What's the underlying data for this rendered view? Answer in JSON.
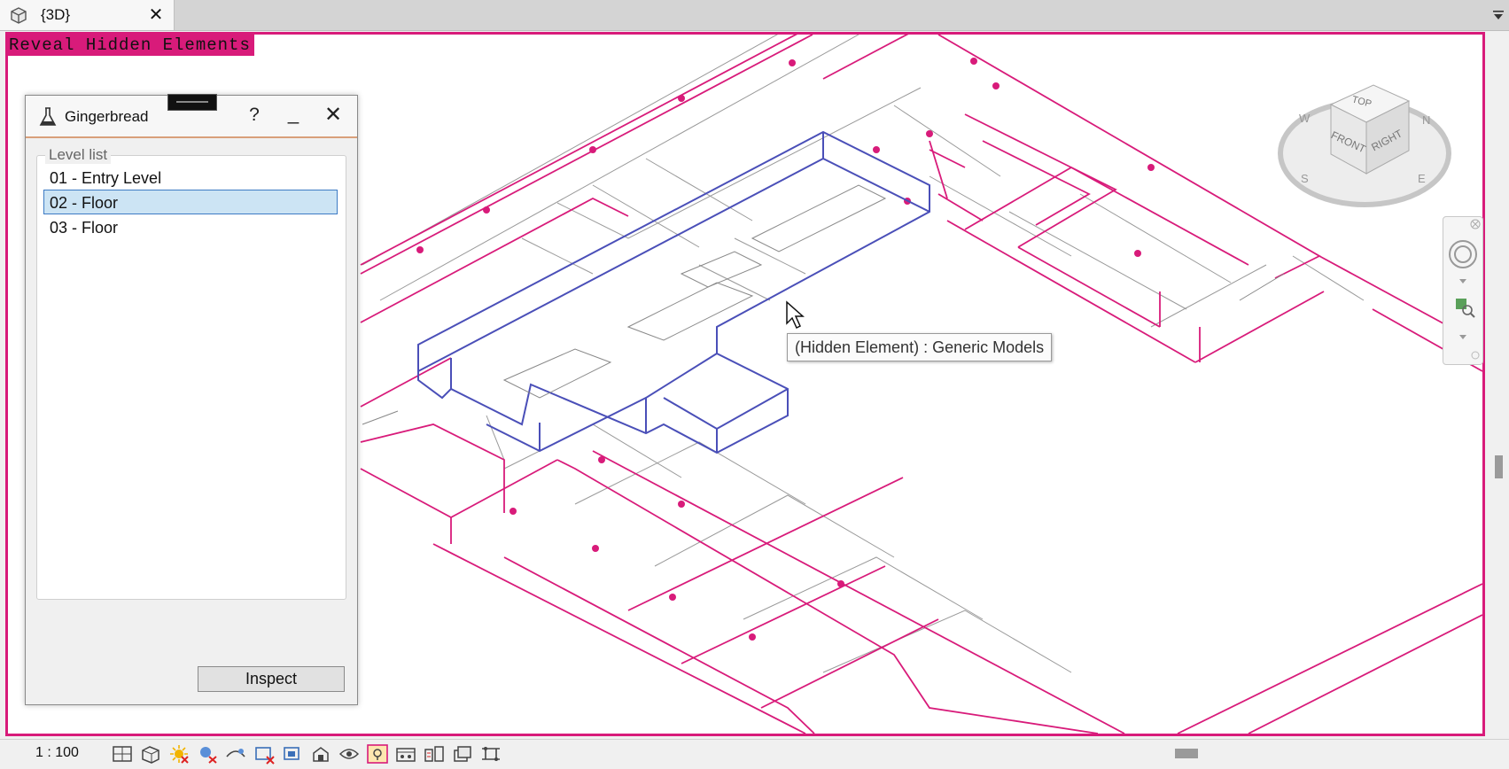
{
  "tab": {
    "label": "{3D}",
    "close": "✕"
  },
  "banner": {
    "text": "Reveal Hidden Elements"
  },
  "dialog": {
    "title": "Gingerbread",
    "help": "?",
    "minimize": "_",
    "close": "✕",
    "group_label": "Level list",
    "levels": [
      {
        "label": "01 - Entry Level",
        "selected": false
      },
      {
        "label": "02 - Floor",
        "selected": true
      },
      {
        "label": "03 - Floor",
        "selected": false
      }
    ],
    "inspect_label": "Inspect"
  },
  "tooltip": {
    "text": "(Hidden Element) : Generic Models"
  },
  "viewcube": {
    "top": "TOP",
    "front": "FRONT",
    "right": "RIGHT",
    "compass": [
      "W",
      "N",
      "S",
      "E"
    ]
  },
  "status": {
    "scale": "1 : 100"
  },
  "colors": {
    "reveal": "#d81b7a",
    "selection": "#4a4fb8",
    "wire": "#555555"
  },
  "icons": [
    "view-template-icon",
    "tab-dropdown-icon",
    "flask-icon",
    "detail-level-icon",
    "visual-style-icon",
    "sun-path-icon",
    "shadows-icon",
    "render-icon",
    "crop-view-icon",
    "show-crop-icon",
    "unlock-3d-icon",
    "temporary-hide-icon",
    "reveal-hidden-icon",
    "worksharing-icon",
    "design-options-icon",
    "highlight-displacement-icon",
    "analytical-model-icon",
    "steering-wheel-icon",
    "zoom-region-icon"
  ]
}
